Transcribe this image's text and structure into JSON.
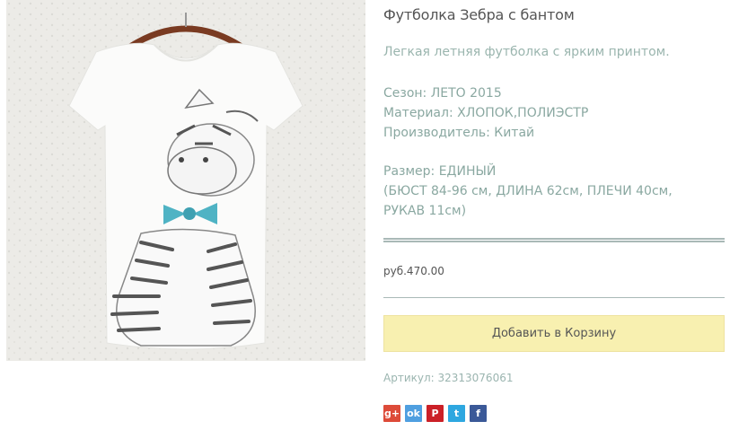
{
  "product": {
    "title": "Футболка Зебра с бантом",
    "description": "Легкая летняя футболка с ярким принтом.",
    "season": "Сезон: ЛЕТО 2015",
    "material": "Материал: ХЛОПОК,ПОЛИЭСТР",
    "manufacturer": "Производитель: Китай",
    "size": "Размер: ЕДИНЫЙ",
    "measurements_line1": "(БЮСТ 84-96 см, ДЛИНА 62см, ПЛЕЧИ 40см,",
    "measurements_line2": "РУКАВ 11см)",
    "price": "руб.470.00",
    "add_to_cart_label": "Добавить в Корзину",
    "sku": "Артикул: 32313076061"
  },
  "share": [
    {
      "icon": "google-plus-icon",
      "glyph": "g+",
      "color": "#dd4b39"
    },
    {
      "icon": "odnoklassniki-icon",
      "glyph": "ok",
      "color": "#4f9fe0"
    },
    {
      "icon": "pinterest-icon",
      "glyph": "P",
      "color": "#cb2027"
    },
    {
      "icon": "twitter-icon",
      "glyph": "t",
      "color": "#2ea7e0"
    },
    {
      "icon": "facebook-icon",
      "glyph": "f",
      "color": "#3b5998"
    }
  ]
}
